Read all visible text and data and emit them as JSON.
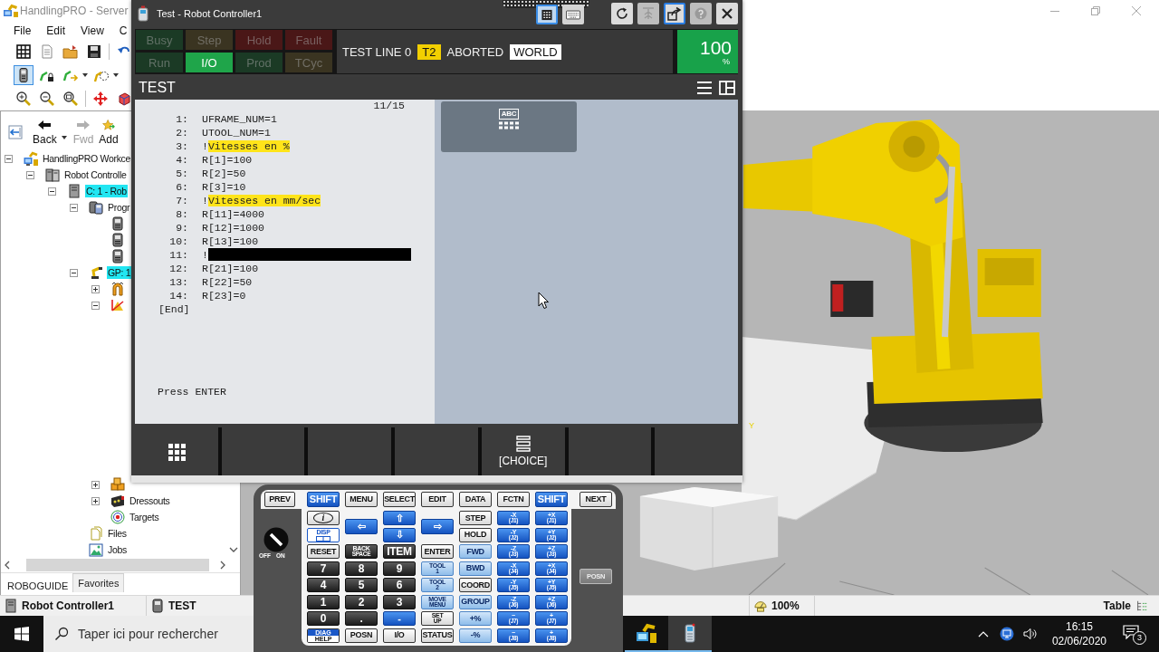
{
  "app": {
    "title": "HandlingPRO - Server",
    "menu": [
      "File",
      "Edit",
      "View",
      "C"
    ],
    "toolbar_rows": [
      [
        {
          "selected": false
        },
        {
          "selected": false
        },
        {
          "selected": false
        },
        {
          "selected": false
        },
        {
          "selected": false
        }
      ],
      [
        {
          "selected": true
        },
        {
          "selected": false
        },
        {
          "selected": false
        },
        {
          "selected": false
        }
      ],
      [
        {
          "selected": false
        },
        {
          "selected": false
        },
        {
          "selected": false
        },
        {
          "selected": false
        },
        {
          "selected": false
        }
      ]
    ]
  },
  "nav": [
    {
      "label": "Back",
      "disabled": false
    },
    {
      "label": "Fwd",
      "disabled": true
    },
    {
      "label": "Add",
      "disabled": false
    }
  ],
  "tree": [
    {
      "label": "HandlingPRO Workce",
      "kind": "workcell",
      "expanded": true,
      "highlighted": false,
      "children": [
        {
          "label": "Robot Controlle",
          "kind": "controller",
          "expanded": true,
          "highlighted": false,
          "children": [
            {
              "label": "C: 1 - Rob",
              "kind": "cell",
              "expanded": true,
              "highlighted": true,
              "children": [
                {
                  "label": "Progr",
                  "kind": "programs",
                  "expanded": true,
                  "highlighted": false,
                  "children": [
                    {
                      "kind": "program"
                    },
                    {
                      "kind": "program"
                    },
                    {
                      "kind": "program"
                    }
                  ]
                },
                {
                  "label": "GP: 1",
                  "kind": "robot",
                  "expanded": true,
                  "highlighted": true,
                  "children": [
                    {
                      "kind": "tooling",
                      "expanded": false
                    },
                    {
                      "kind": "frames",
                      "expanded": true
                    },
                    {
                      "kind": "parts",
                      "expanded": false
                    },
                    {
                      "label": "Dressouts",
                      "kind": "dressouts",
                      "expanded": false,
                      "highlighted": false
                    },
                    {
                      "label": "Targets",
                      "kind": "targets",
                      "highlighted": false
                    }
                  ]
                },
                {
                  "label": "Files",
                  "kind": "files",
                  "highlighted": false
                },
                {
                  "label": "Jobs",
                  "kind": "jobs",
                  "highlighted": false
                }
              ]
            }
          ]
        }
      ]
    }
  ],
  "panel_tabs": [
    {
      "label": "ROBOGUIDE",
      "selected": true
    },
    {
      "label": "Favorites",
      "selected": false
    }
  ],
  "viewport": {
    "axis_label": "Y"
  },
  "status_bar": {
    "controller": "Robot Controller1",
    "program": "TEST",
    "zoom": "100%",
    "view": "Table"
  },
  "pendant": {
    "title": "Test - Robot Controller1",
    "tray_buttons": [
      {
        "selected": true
      },
      {
        "selected": false
      }
    ],
    "window_buttons": [
      {
        "disabled": false,
        "selected": false
      },
      {
        "disabled": true,
        "selected": false
      },
      {
        "disabled": false,
        "selected": true
      },
      {
        "disabled": true,
        "selected": false
      },
      {
        "disabled": false,
        "selected": false
      }
    ],
    "status_lamps": [
      {
        "label": "Busy",
        "color": "#1b3a25",
        "on": false
      },
      {
        "label": "Step",
        "color": "#3a3421",
        "on": false
      },
      {
        "label": "Hold",
        "color": "#4a1717",
        "on": false
      },
      {
        "label": "Fault",
        "color": "#4a1717",
        "on": false
      },
      {
        "label": "Run",
        "color": "#1b3a25",
        "on": false
      },
      {
        "label": "I/O",
        "color": "#1fa54a",
        "on": true
      },
      {
        "label": "Prod",
        "color": "#1b3a25",
        "on": false
      },
      {
        "label": "TCyc",
        "color": "#3a3421",
        "on": false
      }
    ],
    "status_line": {
      "program": "TEST LINE 0",
      "mode": "T2",
      "state": "ABORTED",
      "frame": "WORLD"
    },
    "override": {
      "value": "100",
      "unit": "%"
    },
    "screen": {
      "title": "TEST",
      "position": "11/15",
      "lines": [
        {
          "number": "1:",
          "kind": "instruction",
          "text": "UFRAME_NUM=1"
        },
        {
          "number": "2:",
          "kind": "instruction",
          "text": "UTOOL_NUM=1"
        },
        {
          "number": "3:",
          "kind": "comment",
          "mark": "!",
          "text": "Vitesses en %"
        },
        {
          "number": "4:",
          "kind": "instruction",
          "text": "R[1]=100"
        },
        {
          "number": "5:",
          "kind": "instruction",
          "text": "R[2]=50"
        },
        {
          "number": "6:",
          "kind": "instruction",
          "text": "R[3]=10"
        },
        {
          "number": "7:",
          "kind": "comment",
          "mark": "!",
          "text": "Vitesses en mm/sec"
        },
        {
          "number": "8:",
          "kind": "instruction",
          "text": "R[11]=4000"
        },
        {
          "number": "9:",
          "kind": "instruction",
          "text": "R[12]=1000"
        },
        {
          "number": "10:",
          "kind": "instruction",
          "text": "R[13]=100"
        },
        {
          "number": "11:",
          "kind": "edit",
          "mark": "!"
        },
        {
          "number": "12:",
          "kind": "instruction",
          "text": "R[21]=100"
        },
        {
          "number": "13:",
          "kind": "instruction",
          "text": "R[22]=50"
        },
        {
          "number": "14:",
          "kind": "instruction",
          "text": "R[23]=0"
        },
        {
          "kind": "end",
          "text": "[End]"
        }
      ],
      "prompt": "Press ENTER",
      "keyboard_label": "ABC"
    },
    "function_keys": [
      {
        "kind": "menu"
      },
      {
        "kind": "blank"
      },
      {
        "kind": "blank"
      },
      {
        "kind": "blank"
      },
      {
        "kind": "choice",
        "label": "[CHOICE]"
      },
      {
        "kind": "blank"
      },
      {
        "kind": "blank"
      }
    ]
  },
  "keypad": {
    "top_row": [
      {
        "label": "PREV",
        "kind": "light"
      },
      {
        "label": "SHIFT",
        "kind": "blue"
      },
      {
        "label": "MENU",
        "kind": "light"
      },
      {
        "label": "SELECT",
        "kind": "light"
      },
      {
        "label": "EDIT",
        "kind": "light"
      },
      {
        "label": "DATA",
        "kind": "light"
      },
      {
        "label": "FCTN",
        "kind": "light"
      },
      {
        "label": "SHIFT",
        "kind": "blue"
      },
      {
        "label": "NEXT",
        "kind": "light"
      }
    ],
    "keys": [
      {
        "label": "i",
        "kind": "info"
      },
      {
        "label": "⇦",
        "kind": "arrow"
      },
      {
        "label": "⇧",
        "kind": "blue"
      },
      {
        "label": "⇨",
        "kind": "arrow"
      },
      {
        "label": "STEP",
        "kind": "light"
      },
      {
        "label": "-X",
        "sub": "(J1)",
        "kind": "blue"
      },
      {
        "label": "+X",
        "sub": "(J1)",
        "kind": "blue"
      },
      {
        "label": "DISP",
        "kind": "disp"
      },
      {
        "label": "⇩",
        "kind": "blue"
      },
      {
        "label": "HOLD",
        "kind": "light"
      },
      {
        "label": "-Y",
        "sub": "(J2)",
        "kind": "blue"
      },
      {
        "label": "+Y",
        "sub": "(J2)",
        "kind": "blue"
      },
      {
        "label": "RESET",
        "kind": "light"
      },
      {
        "label": "BACK",
        "sub": "SPACE",
        "kind": "dark"
      },
      {
        "label": "ITEM",
        "kind": "dark"
      },
      {
        "label": "ENTER",
        "kind": "light"
      },
      {
        "label": "FWD",
        "kind": "pale"
      },
      {
        "label": "-Z",
        "sub": "(J3)",
        "kind": "blue"
      },
      {
        "label": "+Z",
        "sub": "(J3)",
        "kind": "blue"
      },
      {
        "label": "7",
        "kind": "dark"
      },
      {
        "label": "8",
        "kind": "dark"
      },
      {
        "label": "9",
        "kind": "dark"
      },
      {
        "label": "TOOL",
        "sub": "1",
        "kind": "pale"
      },
      {
        "label": "BWD",
        "kind": "pale"
      },
      {
        "label": "-X",
        "sub": "(J4)",
        "kind": "blue"
      },
      {
        "label": "+X",
        "sub": "(J4)",
        "kind": "blue"
      },
      {
        "label": "4",
        "kind": "dark"
      },
      {
        "label": "5",
        "kind": "dark"
      },
      {
        "label": "6",
        "kind": "dark"
      },
      {
        "label": "TOOL",
        "sub": "2",
        "kind": "pale"
      },
      {
        "label": "COORD",
        "kind": "light"
      },
      {
        "label": "-Y",
        "sub": "(J5)",
        "kind": "blue"
      },
      {
        "label": "+Y",
        "sub": "(J5)",
        "kind": "blue"
      },
      {
        "label": "1",
        "kind": "dark"
      },
      {
        "label": "2",
        "kind": "dark"
      },
      {
        "label": "3",
        "kind": "dark"
      },
      {
        "label": "MOVE",
        "sub": "MENU",
        "kind": "pale"
      },
      {
        "label": "GROUP",
        "kind": "pale"
      },
      {
        "label": "-Z",
        "sub": "(J6)",
        "kind": "blue"
      },
      {
        "label": "+Z",
        "sub": "(J6)",
        "kind": "blue"
      },
      {
        "label": "0",
        "kind": "dark"
      },
      {
        "label": ".",
        "kind": "dark"
      },
      {
        "label": "-",
        "kind": "blue"
      },
      {
        "label": "SET",
        "sub": "UP",
        "kind": "light"
      },
      {
        "label": "+%",
        "kind": "pale"
      },
      {
        "label": "−",
        "sub": "(J7)",
        "kind": "blue"
      },
      {
        "label": "+",
        "sub": "(J7)",
        "kind": "blue"
      },
      {
        "label": "DIAG",
        "sub": "HELP",
        "kind": "split"
      },
      {
        "label": "POSN",
        "kind": "light"
      },
      {
        "label": "I/O",
        "kind": "light"
      },
      {
        "label": "STATUS",
        "kind": "light"
      },
      {
        "label": "-%",
        "kind": "pale"
      },
      {
        "label": "−",
        "sub": "(J8)",
        "kind": "blue"
      },
      {
        "label": "+",
        "sub": "(J8)",
        "kind": "blue"
      }
    ],
    "switch": [
      "OFF",
      "ON"
    ],
    "side_key": "POSN"
  },
  "taskbar": {
    "search": {
      "placeholder": "Taper ici pour rechercher"
    },
    "apps": [
      {
        "active": false
      },
      {
        "active": true
      }
    ],
    "time": "16:15",
    "date": "02/06/2020",
    "notifications": "3"
  }
}
